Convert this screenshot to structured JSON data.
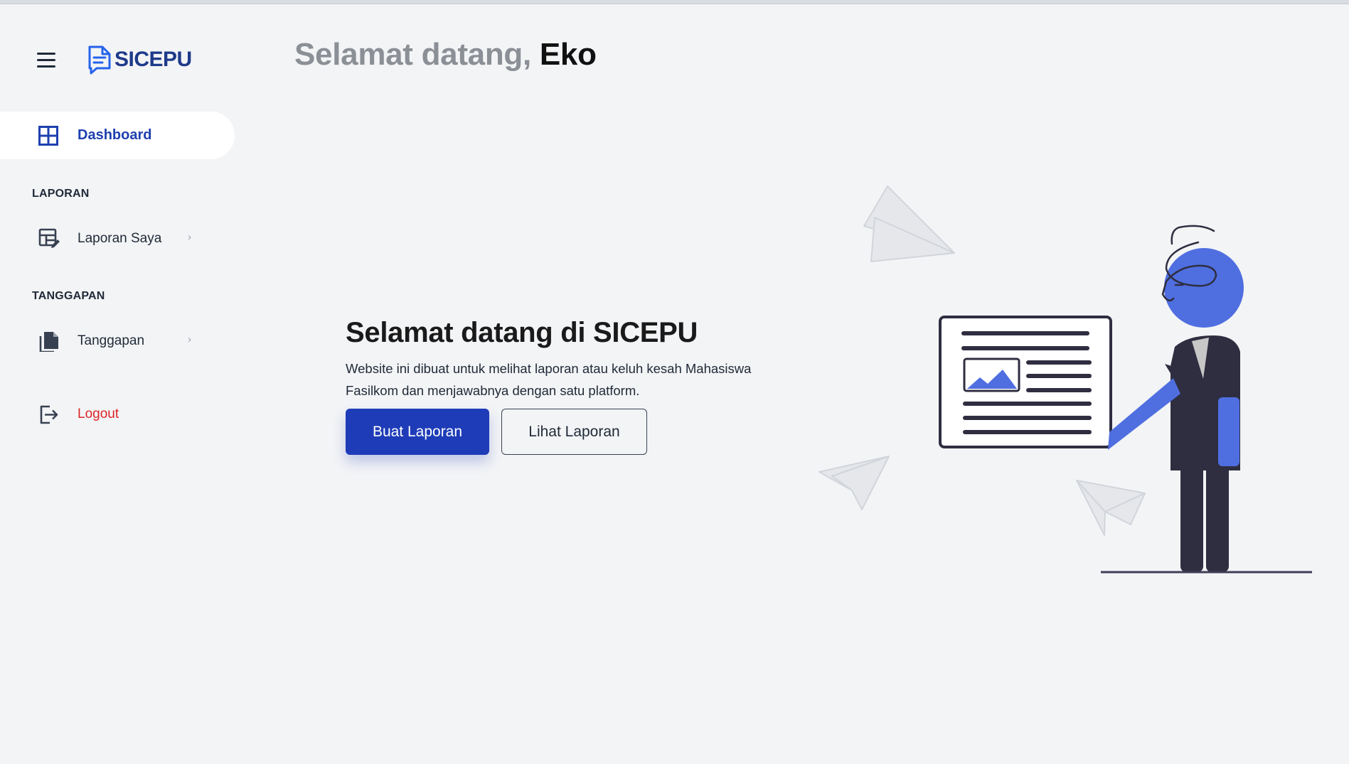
{
  "app": {
    "name": "SICEPU"
  },
  "header": {
    "greeting_prefix": "Selamat datang,",
    "user_name": "Eko"
  },
  "sidebar": {
    "active_item": {
      "label": "Dashboard",
      "icon": "grid-icon"
    },
    "sections": [
      {
        "title": "LAPORAN",
        "items": [
          {
            "label": "Laporan Saya",
            "icon": "report-edit-icon",
            "chevron": "›"
          }
        ]
      },
      {
        "title": "TANGGAPAN",
        "items": [
          {
            "label": "Tanggapan",
            "icon": "documents-icon",
            "chevron": "›"
          }
        ]
      }
    ],
    "logout": {
      "label": "Logout",
      "icon": "logout-icon"
    }
  },
  "hero": {
    "title": "Selamat datang di SICEPU",
    "description": "Website ini dibuat untuk melihat laporan atau keluh kesah Mahasiswa Fasilkom dan menjawabnya dengan satu platform.",
    "primary_button": "Buat Laporan",
    "secondary_button": "Lihat Laporan"
  },
  "colors": {
    "primary": "#1e3cb8",
    "brand_text": "#1e3a8a",
    "accent_illustration": "#4f6fe0",
    "logout": "#dc2626",
    "background": "#f3f4f6"
  }
}
